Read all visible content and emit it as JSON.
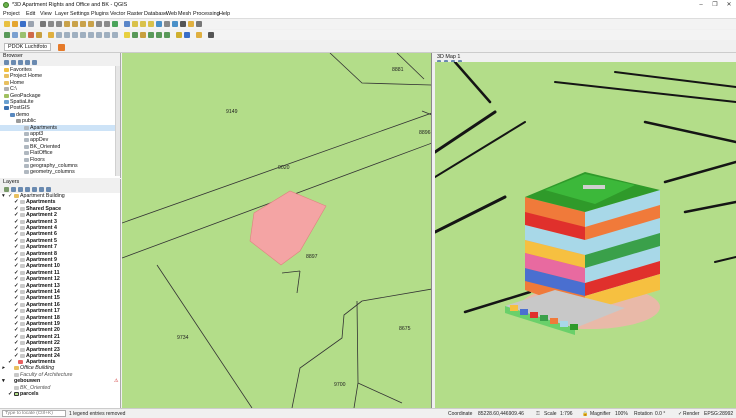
{
  "window": {
    "title": "*3D Apartment Rights and Office and BK - QGIS"
  },
  "menubar": [
    "Project",
    "Edit",
    "View",
    "Layer",
    "Settings",
    "Plugins",
    "Vector",
    "Raster",
    "Database",
    "Web",
    "Mesh",
    "Processing",
    "Help"
  ],
  "project_tab": {
    "label": "PDOK Luchtfoto"
  },
  "browser": {
    "title": "Browser",
    "items": [
      "Favorites",
      "Project Home",
      "Home",
      "C:\\",
      "GeoPackage",
      "SpatiaLite",
      "PostGIS",
      "demo",
      "public",
      "Apartments",
      "appt3",
      "appDev",
      "BK_Oriented",
      "FlatOffice",
      "Floors",
      "geography_columns",
      "geometry_columns"
    ]
  },
  "layers": {
    "title": "Layers",
    "group": "Apartment Building",
    "items": [
      "Apartments",
      "Shared Space",
      "Apartment 2",
      "Apartment 3",
      "Apartment 4",
      "Apartment 6",
      "Apartment 5",
      "Apartment 7",
      "Apartment 8",
      "Apartment 9",
      "Apartment 10",
      "Apartment 11",
      "Apartment 12",
      "Apartment 13",
      "Apartment 14",
      "Apartment 15",
      "Apartment 16",
      "Apartment 17",
      "Apartment 18",
      "Apartment 19",
      "Apartment 20",
      "Apartment 21",
      "Apartment 22",
      "Apartment 23",
      "Apartment 24"
    ],
    "apartments_layer": "Apartments",
    "office_building": "Office Building",
    "faculty": "Faculty of Architecture",
    "gebouwen": "gebouwen",
    "bk_oriented": "BK_Oriented",
    "parcels": "parcels"
  },
  "map2d": {
    "parcel_labels": [
      {
        "label": "8881"
      },
      {
        "label": "9149"
      },
      {
        "label": "8896"
      },
      {
        "label": "9020"
      },
      {
        "label": "8897"
      },
      {
        "label": "8675"
      },
      {
        "label": "9734"
      },
      {
        "label": "9700"
      }
    ]
  },
  "map3d": {
    "title": "3D Map 1"
  },
  "statusbar": {
    "locator_placeholder": "Type to locate (Ctrl+K)",
    "message": "1 legend entries removed",
    "coordinate_label": "Coordinate",
    "coordinate": "85228.60,446909.46",
    "scale_label": "Scale",
    "scale": "1:796",
    "magnifier_label": "Magnifier",
    "magnifier": "100%",
    "rotation_label": "Rotation",
    "rotation": "0.0 °",
    "render_label": "Render",
    "epsg": "EPSG:28992"
  },
  "colors": {
    "map_bg": "#b3dd89",
    "selected_parcel": "#f4a4a4",
    "lines": "#333333"
  }
}
